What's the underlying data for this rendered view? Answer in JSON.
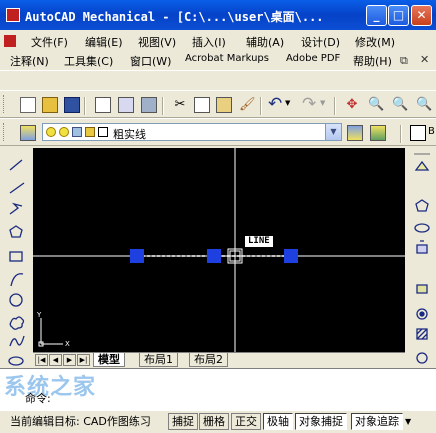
{
  "window": {
    "title": "AutoCAD Mechanical - [C:\\...\\user\\桌面\\..."
  },
  "menu": {
    "row1": [
      "文件(F)",
      "编辑(E)",
      "视图(V)",
      "插入(I)",
      "辅助(A)",
      "设计(D)",
      "修改(M)"
    ],
    "row2": [
      "注释(N)",
      "工具集(C)",
      "窗口(W)",
      "Acrobat Markups",
      "Adobe PDF",
      "帮助(H)"
    ]
  },
  "layer": {
    "selected": "粗实线"
  },
  "canvas": {
    "tooltip": "LINE",
    "ucs_x": "X",
    "ucs_y": "Y"
  },
  "tabs": [
    "模型",
    "布局1",
    "布局2"
  ],
  "command": {
    "prompt": "命令:",
    "watermark": "系统之家"
  },
  "status": {
    "left_text": "当前编辑目标: CAD作图练习",
    "buttons": [
      "捕捉",
      "栅格",
      "正交",
      "极轴",
      "对象捕捉",
      "对象追踪"
    ],
    "pressed": [
      "极轴",
      "对象捕捉",
      "对象追踪"
    ]
  },
  "colors": {
    "title_blue": "#0542c8",
    "canvas_bg": "#000000",
    "grip_blue": "#1e40e0",
    "crosshair": "#ffffff"
  }
}
